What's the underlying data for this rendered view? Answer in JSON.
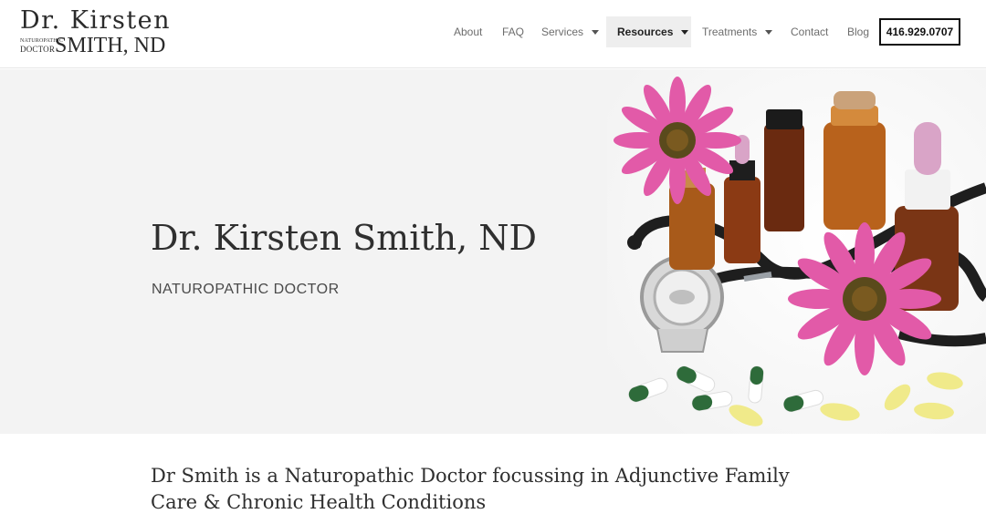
{
  "logo": {
    "line1": "Dr. Kirsten",
    "small1": "Naturopathic",
    "small2": "Doctor",
    "line2": "SMITH, ND"
  },
  "nav": {
    "items": [
      {
        "label": "About",
        "dropdown": false,
        "active": false
      },
      {
        "label": "FAQ",
        "dropdown": false,
        "active": false
      },
      {
        "label": "Services",
        "dropdown": true,
        "active": false
      },
      {
        "label": "Resources",
        "dropdown": true,
        "active": true
      },
      {
        "label": "Treatments",
        "dropdown": true,
        "active": false
      },
      {
        "label": "Contact",
        "dropdown": false,
        "active": false
      },
      {
        "label": "Blog",
        "dropdown": false,
        "active": false
      }
    ],
    "phone": "416.929.0707"
  },
  "hero": {
    "title": "Dr. Kirsten Smith, ND",
    "subtitle": "NATUROPATHIC DOCTOR"
  },
  "intro": {
    "text": "Dr Smith is a Naturopathic Doctor focussing in Adjunctive Family Care & Chronic Health Conditions"
  },
  "colors": {
    "hero_bg": "#f3f3f3",
    "flower_pink": "#e25aa8",
    "flower_center": "#5a4a1c",
    "amber_glass": "#a85a1a",
    "capsule_green": "#2e6b3a",
    "capsule_yellow": "#f0ea8a"
  }
}
